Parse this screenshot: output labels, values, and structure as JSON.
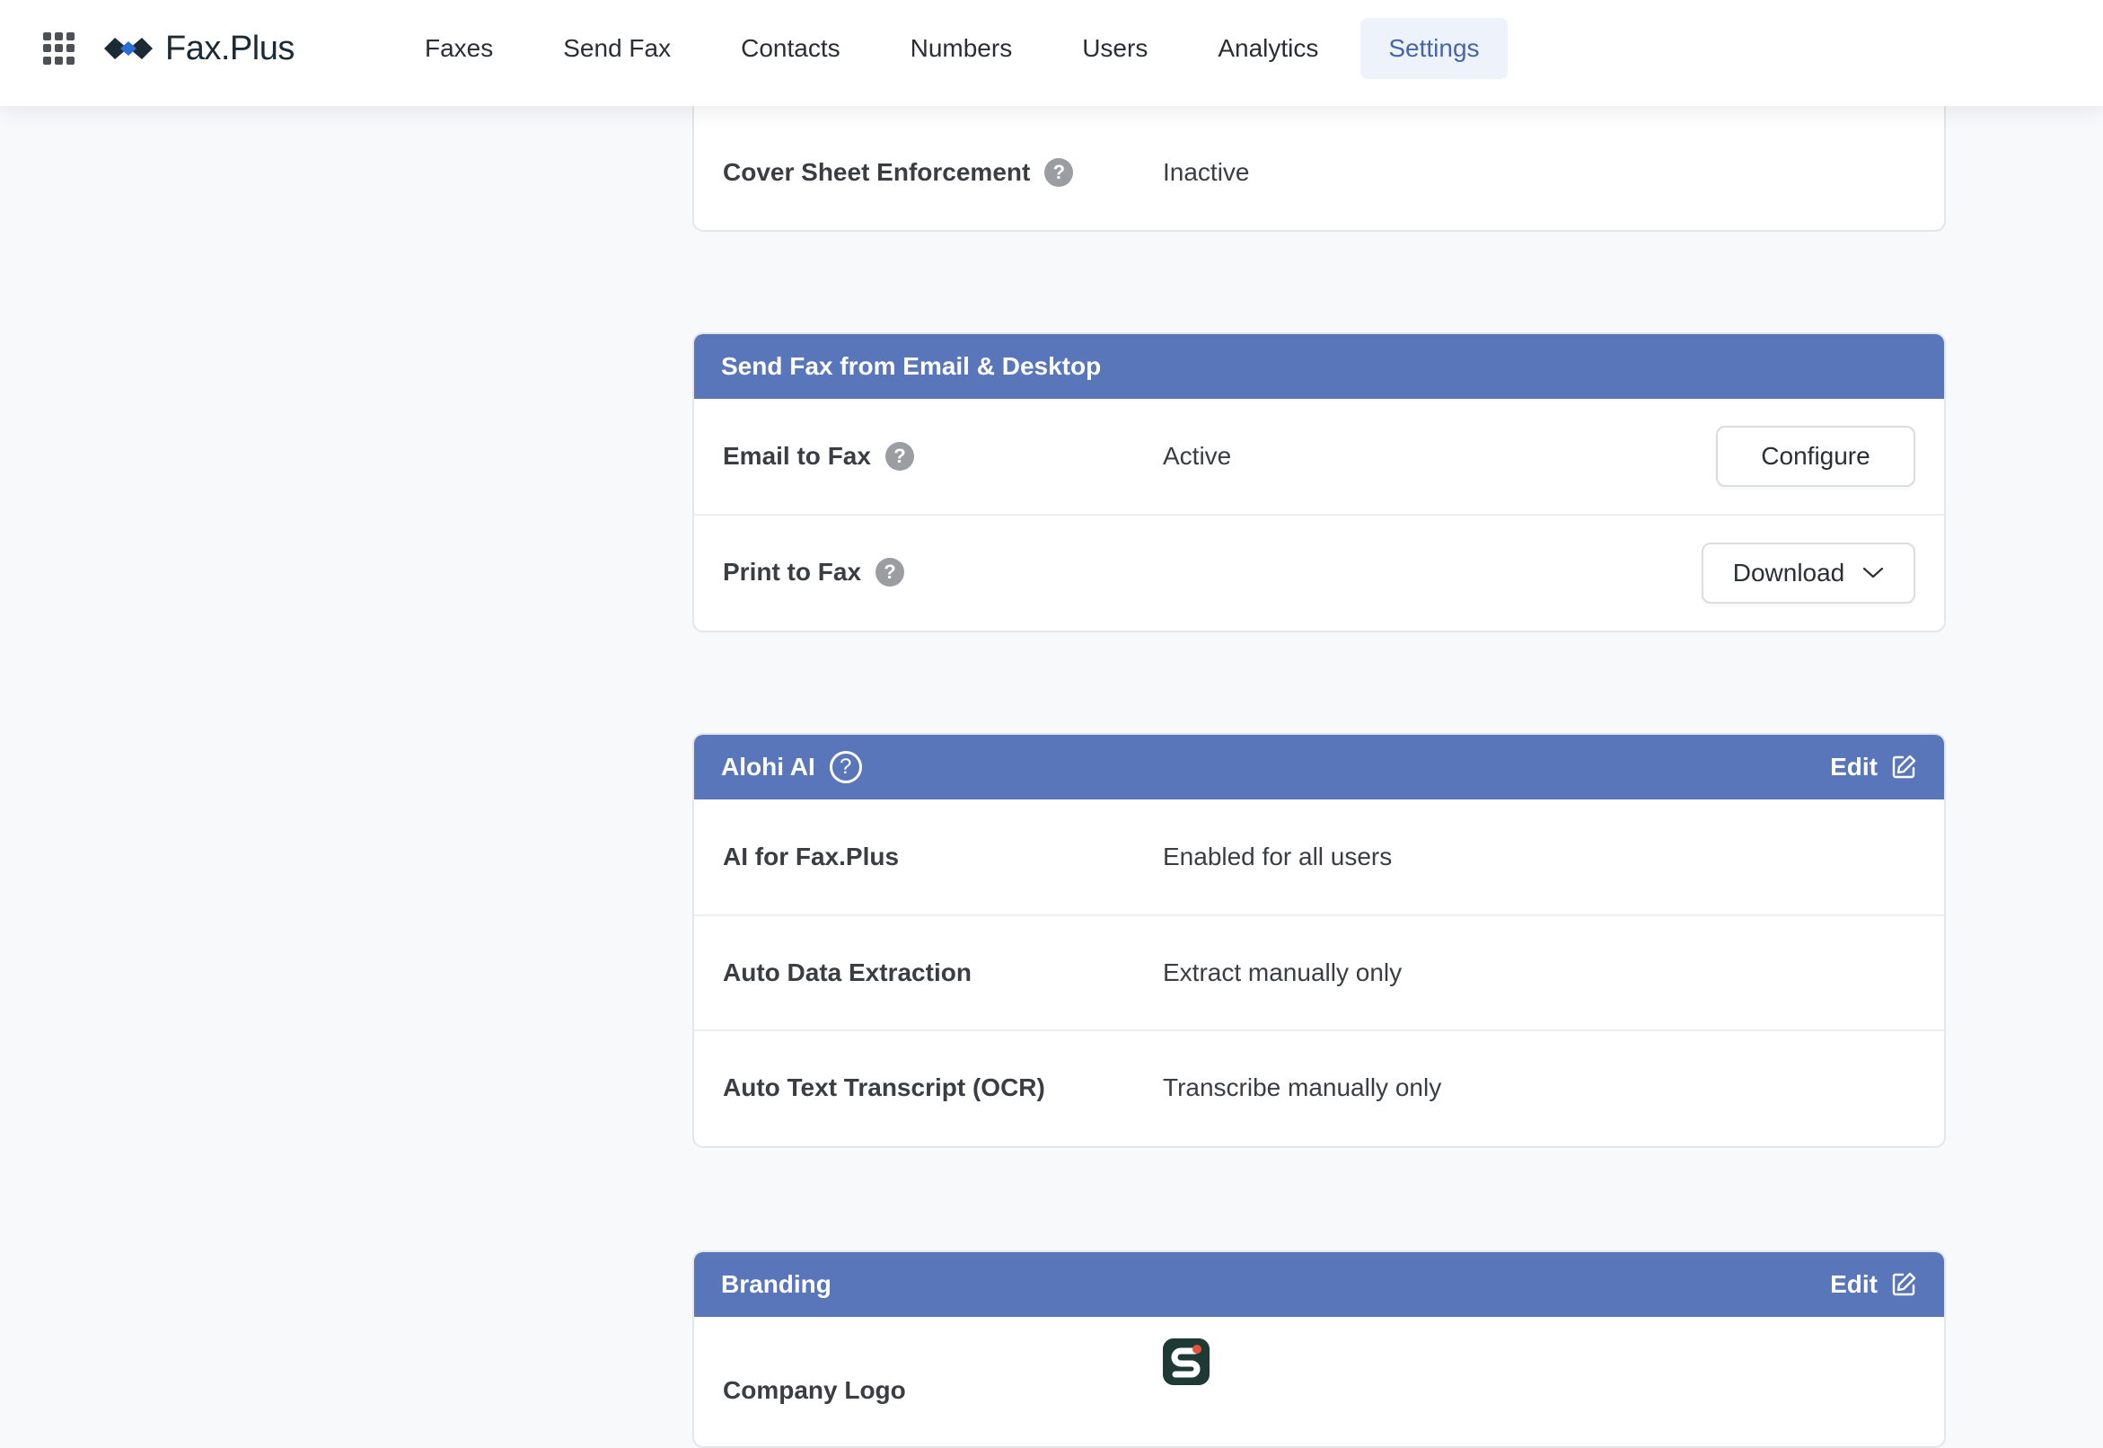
{
  "brand": {
    "name": "Fax.Plus"
  },
  "nav": {
    "items": [
      {
        "label": "Faxes"
      },
      {
        "label": "Send Fax"
      },
      {
        "label": "Contacts"
      },
      {
        "label": "Numbers"
      },
      {
        "label": "Users"
      },
      {
        "label": "Analytics"
      },
      {
        "label": "Settings",
        "active": true
      }
    ]
  },
  "cover_sheet": {
    "label": "Cover Sheet Enforcement",
    "value": "Inactive"
  },
  "send_fax": {
    "title": "Send Fax from Email & Desktop",
    "email_to_fax": {
      "label": "Email to Fax",
      "value": "Active",
      "button": "Configure"
    },
    "print_to_fax": {
      "label": "Print to Fax",
      "button": "Download"
    }
  },
  "alohi_ai": {
    "title": "Alohi AI",
    "edit": "Edit",
    "rows": [
      {
        "label": "AI for Fax.Plus",
        "value": "Enabled for all users"
      },
      {
        "label": "Auto Data Extraction",
        "value": "Extract manually only"
      },
      {
        "label": "Auto Text Transcript (OCR)",
        "value": "Transcribe manually only"
      }
    ]
  },
  "branding": {
    "title": "Branding",
    "edit": "Edit",
    "company_logo": {
      "label": "Company Logo"
    }
  },
  "colors": {
    "header_blue": "#5876b9",
    "nav_active_bg": "#eef2fa",
    "nav_active_text": "#4466a8",
    "page_bg": "#f8f9fb"
  },
  "icons": {
    "apps": "grid-icon",
    "help": "question-icon",
    "edit": "edit-icon",
    "dropdown": "chevron-down-icon"
  }
}
